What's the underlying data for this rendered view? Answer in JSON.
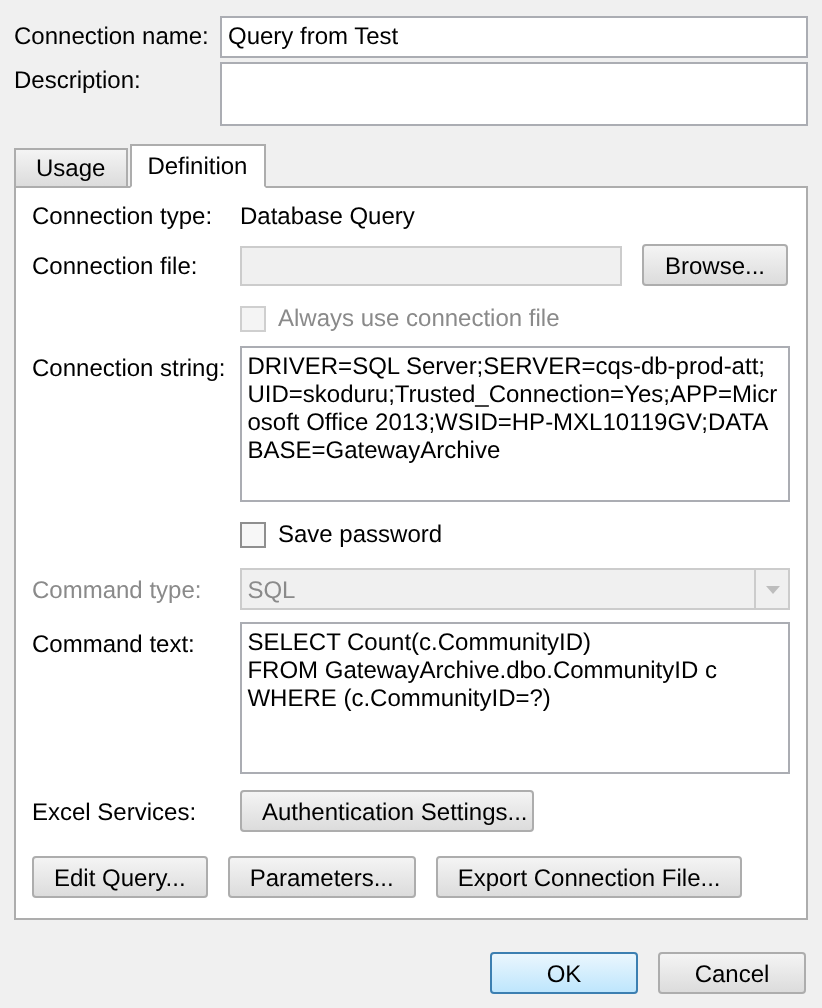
{
  "connection_name": {
    "label": "Connection name:",
    "value": "Query from Test"
  },
  "description": {
    "label": "Description:"
  },
  "tabs": [
    {
      "label": "Usage",
      "selected": false
    },
    {
      "label": "Definition",
      "selected": true
    }
  ],
  "connection_type": {
    "label": "Connection type:",
    "value": "Database Query"
  },
  "connection_file": {
    "label": "Connection file:",
    "disabled": true,
    "button": "Browse..."
  },
  "always_use_connection_file": {
    "label": "Always use connection file",
    "checked": false,
    "disabled": true
  },
  "connection_string": {
    "label": "Connection string:",
    "value": "DRIVER=SQL Server;SERVER=cqs-db-prod-att;UID=skoduru;Trusted_Connection=Yes;APP=Microsoft Office 2013;WSID=HP-MXL10119GV;DATABASE=GatewayArchive"
  },
  "save_password": {
    "label": "Save password",
    "checked": false,
    "disabled": false
  },
  "command_type": {
    "label": "Command type:",
    "value": "SQL",
    "disabled": true
  },
  "command_text": {
    "label": "Command text:",
    "lines": [
      "SELECT Count(c.CommunityID)",
      "FROM GatewayArchive.dbo.CommunityID c",
      "WHERE (c.CommunityID=?)"
    ]
  },
  "excel_services": {
    "label": "Excel Services:",
    "button": "Authentication Settings..."
  },
  "panel_buttons": [
    "Edit Query...",
    "Parameters...",
    "Export Connection File..."
  ],
  "dialog_buttons": [
    {
      "label": "OK",
      "kind": "default"
    },
    {
      "label": "Cancel",
      "kind": "normal"
    }
  ]
}
